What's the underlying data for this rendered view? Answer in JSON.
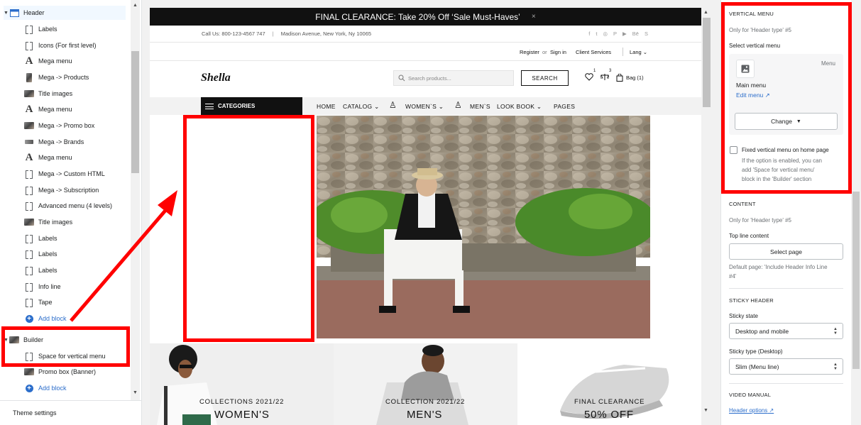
{
  "sidebar": {
    "items": [
      {
        "label": "Header",
        "icon": "header-section-icon",
        "level": 0
      },
      {
        "label": "Labels",
        "icon": "block-icon",
        "level": 1
      },
      {
        "label": "Icons (For first level)",
        "icon": "block-icon",
        "level": 1
      },
      {
        "label": "Mega menu",
        "icon": "font-a-icon",
        "level": 1
      },
      {
        "label": "Mega -> Products",
        "icon": "product-thumbnail-icon",
        "level": 1
      },
      {
        "label": "Title images",
        "icon": "image-thumbnail-icon",
        "level": 1
      },
      {
        "label": "Mega menu",
        "icon": "font-a-icon",
        "level": 1
      },
      {
        "label": "Mega -> Promo box",
        "icon": "image-thumbnail-icon",
        "level": 1
      },
      {
        "label": "Mega -> Brands",
        "icon": "brand-thumbnail-icon",
        "level": 1
      },
      {
        "label": "Mega menu",
        "icon": "font-a-icon",
        "level": 1
      },
      {
        "label": "Mega -> Custom HTML",
        "icon": "block-icon",
        "level": 1
      },
      {
        "label": "Mega -> Subscription",
        "icon": "block-icon",
        "level": 1
      },
      {
        "label": "Advanced menu (4 levels)",
        "icon": "block-icon",
        "level": 1
      },
      {
        "label": "Title images",
        "icon": "image-thumbnail-icon",
        "level": 1
      },
      {
        "label": "Labels",
        "icon": "block-icon",
        "level": 1
      },
      {
        "label": "Labels",
        "icon": "block-icon",
        "level": 1
      },
      {
        "label": "Labels",
        "icon": "block-icon",
        "level": 1
      },
      {
        "label": "Info line",
        "icon": "block-icon",
        "level": 1
      },
      {
        "label": "Tape",
        "icon": "block-icon",
        "level": 1
      },
      {
        "label": "Add block",
        "icon": "add-circle-icon",
        "level": 1
      },
      {
        "label": "Builder",
        "icon": "image-thumbnail-icon",
        "level": 0
      },
      {
        "label": "Space for vertical menu",
        "icon": "block-icon",
        "level": 1
      },
      {
        "label": "Promo box (Banner)",
        "icon": "image-thumbnail-icon",
        "level": 1
      },
      {
        "label": "Add block",
        "icon": "add-circle-icon",
        "level": 1
      }
    ],
    "theme_settings": "Theme settings"
  },
  "preview": {
    "announcement": "FINAL CLEARANCE: Take 20% Off ‘Sale Must-Haves’",
    "announcement_close": "×",
    "phone": "Call Us: 800-123-4567 747",
    "divider": "|",
    "address": "Madison Avenue, New York, Ny 10065",
    "social": [
      "f",
      "t",
      "◎",
      "P",
      "▶",
      "Bē",
      "S"
    ],
    "register": "Register",
    "or": "or",
    "signin": "Sign in",
    "client_services": "Client Services",
    "lang": "Lang",
    "logo": "Shella",
    "search_placeholder": "Search products...",
    "search_button": "SEARCH",
    "wishlist_count": "1",
    "compare_count": "3",
    "bag_label": "Bag (1)",
    "categories": "CATEGORIES",
    "nav": {
      "home": "HOME",
      "catalog": "CATALOG",
      "womens": "WOMEN`S",
      "mens": "MEN`S",
      "lookbook": "LOOK BOOK",
      "pages": "PAGES"
    },
    "collections": [
      {
        "label": "COLLECTIONS 2021/22",
        "title": "WOMEN'S"
      },
      {
        "label": "COLLECTION 2021/22",
        "title": "MEN'S"
      },
      {
        "label": "FINAL CLEARANCE",
        "title": "50% OFF"
      }
    ]
  },
  "right_panel": {
    "vertical_menu_heading": "VERTICAL MENU",
    "only_header_5": "Only for 'Header type' #5",
    "select_vertical_menu": "Select vertical menu",
    "menu_tag": "Menu",
    "menu_name": "Main menu",
    "edit_menu": "Edit menu",
    "change_button": "Change",
    "fixed_checkbox_label": "Fixed vertical menu on home page",
    "fixed_checked": false,
    "fixed_help_1": "If the option is enabled, you can",
    "fixed_help_2": "add 'Space for vertical menu'",
    "fixed_help_3": "block in the 'Builder' section",
    "content_heading": "CONTENT",
    "content_only": "Only for 'Header type' #5",
    "top_line_content": "Top line content",
    "select_page_button": "Select page",
    "default_page_1": "Default page: 'Include Header Info Line",
    "default_page_2": "#4'",
    "sticky_heading": "STICKY HEADER",
    "sticky_state_label": "Sticky state",
    "sticky_state_value": "Desktop and mobile",
    "sticky_type_label": "Sticky type (Desktop)",
    "sticky_type_value": "Slim (Menu line)",
    "video_heading": "VIDEO MANUAL",
    "header_options_link": "Header options"
  },
  "colors": {
    "highlight": "#ff0000",
    "link": "#2c6ecb",
    "announcement_bg": "#111111"
  }
}
